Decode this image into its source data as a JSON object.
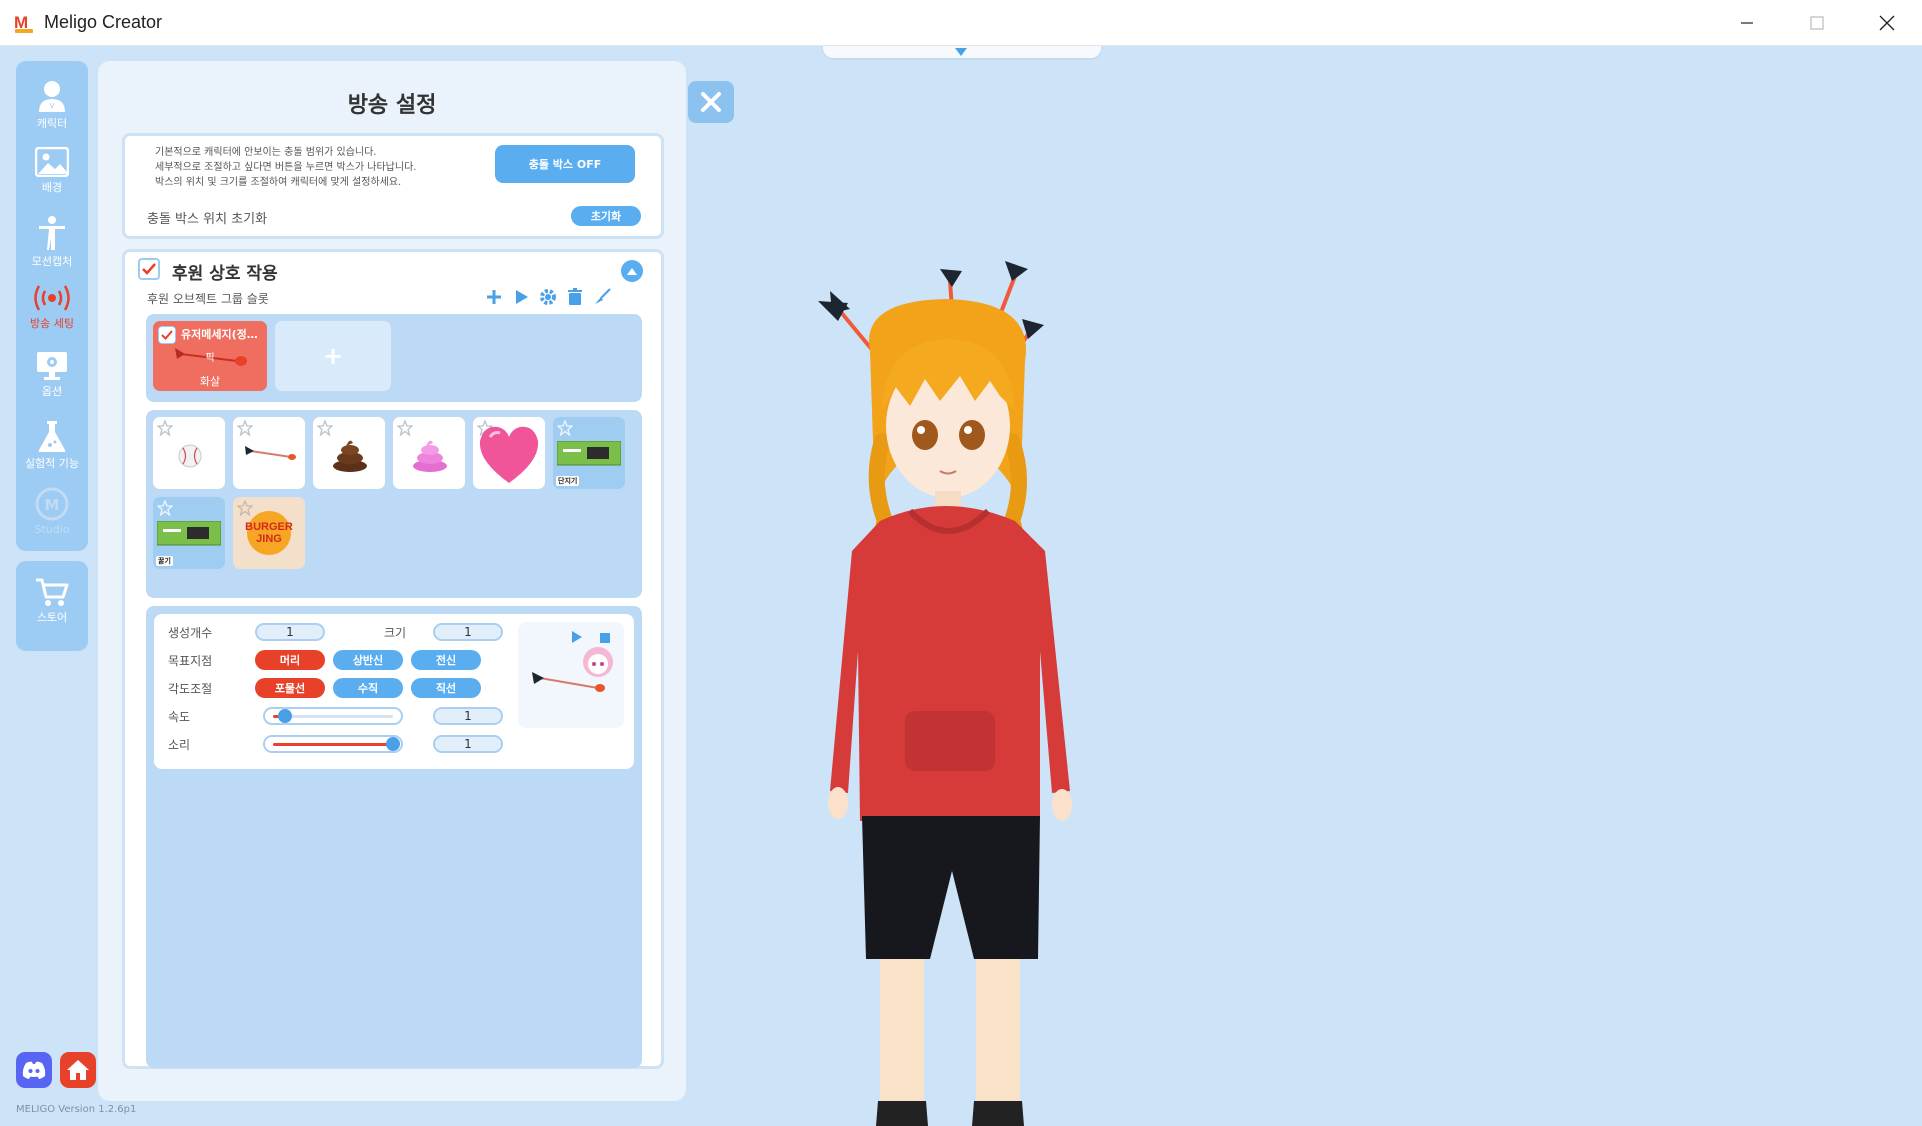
{
  "window": {
    "title": "Meligo Creator"
  },
  "sidebar": {
    "items": [
      {
        "label": "캐릭터",
        "icon": "character-icon"
      },
      {
        "label": "배경",
        "icon": "image-icon"
      },
      {
        "label": "모션캡처",
        "icon": "person-icon"
      },
      {
        "label": "방송 세팅",
        "icon": "broadcast-icon",
        "active": true
      },
      {
        "label": "옵션",
        "icon": "monitor-gear-icon"
      },
      {
        "label": "실험적 기능",
        "icon": "flask-icon"
      },
      {
        "label": "Studio",
        "icon": "studio-logo-icon",
        "disabled": true
      }
    ],
    "store_label": "스토어"
  },
  "panel": {
    "title": "방송 설정",
    "collision": {
      "description": [
        "기본적으로 캐릭터에 안보이는 충돌 범위가 있습니다.",
        "세부적으로 조절하고 싶다면 버튼을 누르면 박스가 나타납니다.",
        "박스의 위치 및 크기를 조절하여 캐릭터에 맞게 설정하세요."
      ],
      "toggle_label": "충돌 박스 OFF",
      "reset_label": "충돌 박스 위치 초기화",
      "reset_button": "초기화"
    },
    "donation": {
      "title": "후원 상호 작용",
      "group_label": "후원 오브젝트 그룹 슬롯",
      "active_slot": {
        "name": "유저메세지(정…",
        "line1": "픽",
        "line2": "화살"
      },
      "add_slot": "+",
      "items": [
        {
          "name": "baseball",
          "tag": ""
        },
        {
          "name": "arrow",
          "tag": ""
        },
        {
          "name": "poop-brown",
          "tag": ""
        },
        {
          "name": "poop-pink",
          "tag": ""
        },
        {
          "name": "heart",
          "tag": ""
        },
        {
          "name": "ram-card",
          "tag": "단지기"
        },
        {
          "name": "ram-card-2",
          "tag": "꿀기"
        },
        {
          "name": "burger-jing",
          "tag": ""
        }
      ],
      "burger_text": "BURGER JING",
      "settings": {
        "count_label": "생성개수",
        "count_value": "1",
        "size_label": "크기",
        "size_value": "1",
        "target_label": "목표지점",
        "target_options": [
          "머리",
          "상반신",
          "전신"
        ],
        "target_selected": 0,
        "angle_label": "각도조절",
        "angle_options": [
          "포물선",
          "수직",
          "직선"
        ],
        "angle_selected": 0,
        "speed_label": "속도",
        "speed_value": "1",
        "speed_level": 0.1,
        "sound_label": "소리",
        "sound_value": "1",
        "sound_level": 1.0
      }
    }
  },
  "footer": {
    "version": "MELIGO Version 1.2.6p1"
  },
  "colors": {
    "accent": "#5aaef0",
    "active": "#e8412a",
    "sidebar": "#9ccbf4"
  }
}
